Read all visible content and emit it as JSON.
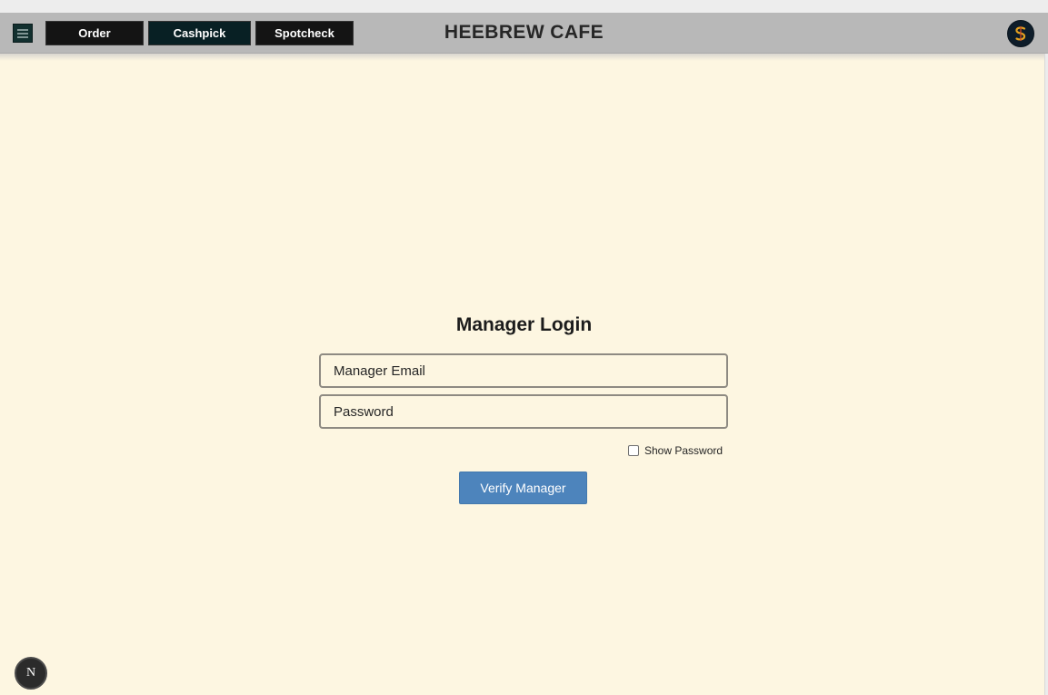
{
  "header": {
    "tabs": [
      {
        "label": "Order"
      },
      {
        "label": "Cashpick"
      },
      {
        "label": "Spotcheck"
      }
    ],
    "title": "HEEBREW CAFE",
    "menu_icon": "hamburger-icon",
    "account_icon": "coin-logo-icon"
  },
  "login": {
    "title": "Manager Login",
    "email_placeholder": "Manager Email",
    "password_placeholder": "Password",
    "show_password_label": "Show Password",
    "verify_button_label": "Verify Manager"
  },
  "floating_badge": {
    "label": "N"
  },
  "colors": {
    "header_bg": "#b8b8b8",
    "page_bg": "#fdf6e1",
    "tab_bg": "#141414",
    "active_tab_bg": "#082024",
    "primary_button": "#4d84bc"
  }
}
